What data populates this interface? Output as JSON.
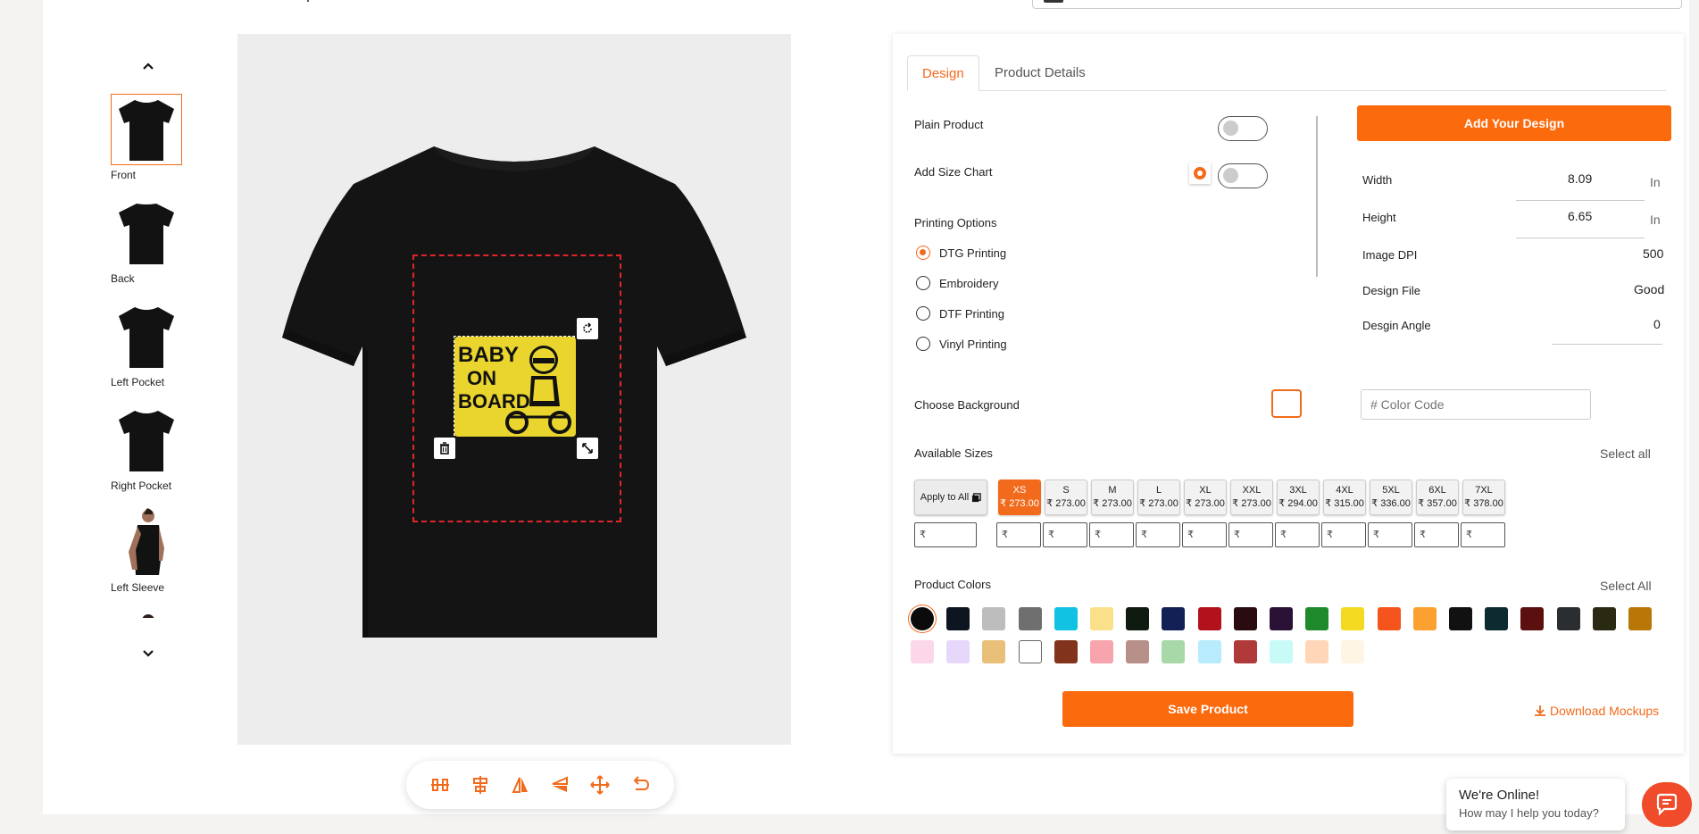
{
  "thumbnails": {
    "items": [
      {
        "label": "Front",
        "active": true
      },
      {
        "label": "Back"
      },
      {
        "label": "Left Pocket"
      },
      {
        "label": "Right Pocket"
      },
      {
        "label": "Left Sleeve"
      }
    ]
  },
  "design": {
    "artwork_text_line1": "BABY",
    "artwork_text_line2": "ON",
    "artwork_text_line3": "BOARD",
    "shirt_color": "#141414",
    "print_color": "#e9d52e"
  },
  "panel": {
    "tabs": [
      {
        "label": "Design",
        "active": true
      },
      {
        "label": "Product Details"
      }
    ],
    "plain_product_label": "Plain Product",
    "add_size_chart_label": "Add Size Chart",
    "printing_options_label": "Printing Options",
    "printing_options": [
      {
        "label": "DTG Printing",
        "selected": true
      },
      {
        "label": "Embroidery"
      },
      {
        "label": "DTF Printing"
      },
      {
        "label": "Vinyl Printing"
      }
    ],
    "add_design_label": "Add Your Design",
    "width_label": "Width",
    "width_value": "8.09",
    "height_label": "Height",
    "height_value": "6.65",
    "unit": "In",
    "dpi_label": "Image DPI",
    "dpi_value": "500",
    "design_file_label": "Design File",
    "design_file_value": "Good",
    "design_angle_label": "Desgin Angle",
    "design_angle_value": "0",
    "choose_background_label": "Choose Background",
    "color_code_placeholder": "# Color Code",
    "available_sizes_label": "Available Sizes",
    "select_all_sizes": "Select all",
    "apply_to_all": "Apply to All",
    "sizes": [
      {
        "size": "XS",
        "price": "₹ 273.00",
        "selected": true
      },
      {
        "size": "S",
        "price": "₹ 273.00"
      },
      {
        "size": "M",
        "price": "₹ 273.00"
      },
      {
        "size": "L",
        "price": "₹ 273.00"
      },
      {
        "size": "XL",
        "price": "₹ 273.00"
      },
      {
        "size": "XXL",
        "price": "₹ 273.00"
      },
      {
        "size": "3XL",
        "price": "₹ 294.00"
      },
      {
        "size": "4XL",
        "price": "₹ 315.00"
      },
      {
        "size": "5XL",
        "price": "₹ 336.00"
      },
      {
        "size": "6XL",
        "price": "₹ 357.00"
      },
      {
        "size": "7XL",
        "price": "₹ 378.00"
      }
    ],
    "rupee_symbol": "₹",
    "product_colors_label": "Product Colors",
    "select_all_colors": "Select All",
    "colors_row1": [
      "#0b0b0b",
      "#0d1620",
      "#bdbdbd",
      "#6f6f6f",
      "#12c2e3",
      "#fbe08a",
      "#0f1a10",
      "#122056",
      "#b3121d",
      "#2a0b10",
      "#2a1236",
      "#1e8a2b",
      "#f3d920",
      "#f5541d",
      "#fca12f",
      "#111111",
      "#0d2a30",
      "#5b0f0f",
      "#2b2e30",
      "#2a2a12",
      "#b97708"
    ],
    "colors_row2": [
      "#fcd7ea",
      "#e7d8fb",
      "#e8c07a",
      "#ffffff",
      "#82331c",
      "#f7a4ac",
      "#b8908a",
      "#a8d8a8",
      "#b8ebfb",
      "#b0393a",
      "#c8fbf8",
      "#ffd7b8",
      "#fff5e4"
    ],
    "save_label": "Save Product",
    "download_label": "Download Mockups"
  },
  "chat": {
    "title": "We're Online!",
    "subtitle": "How may I help you today?"
  }
}
